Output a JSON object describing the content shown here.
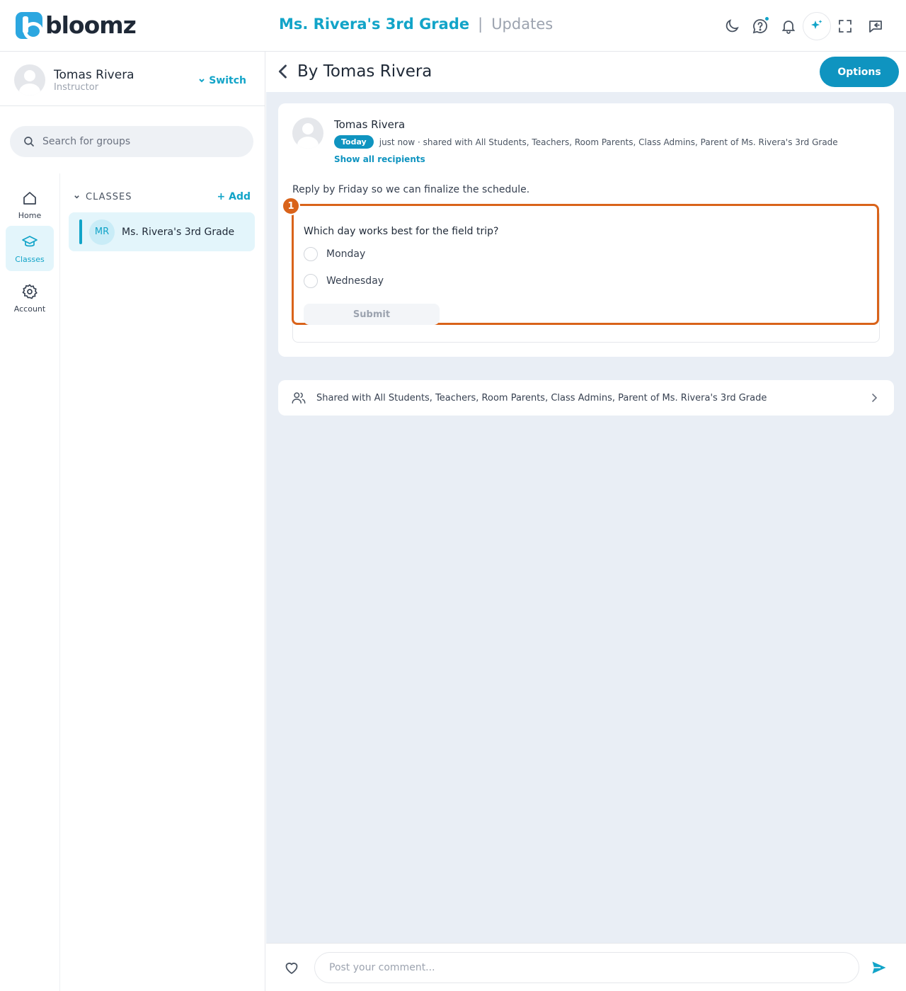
{
  "app": {
    "logo_text": "bloomz",
    "brand_color": "#12a4c8",
    "accent_color": "#0f94c0",
    "highlight_color": "#d9631a"
  },
  "header": {
    "class_name": "Ms. Rivera's 3rd Grade",
    "separator": "|",
    "page": "Updates",
    "icons": [
      "moon-icon",
      "help-chat-icon",
      "bell-icon",
      "sparkle-ai-icon",
      "fullscreen-icon",
      "collapse-panel-icon"
    ]
  },
  "user": {
    "name": "Tomas Rivera",
    "role": "Instructor",
    "switch_label": "Switch"
  },
  "search": {
    "placeholder": "Search for groups"
  },
  "rail": {
    "home": "Home",
    "classes": "Classes",
    "account": "Account"
  },
  "classes": {
    "title": "CLASSES",
    "add_label": "+ Add",
    "items": [
      {
        "initials": "MR",
        "name": "Ms. Rivera's 3rd Grade"
      }
    ]
  },
  "main": {
    "title": "By Tomas Rivera",
    "options_label": "Options"
  },
  "post": {
    "author": "Tomas Rivera",
    "badge": "Today",
    "meta": "just now · shared with All Students, Teachers, Room Parents, Class Admins, Parent of Ms. Rivera's 3rd Grade",
    "show_all": "Show all recipients",
    "body": "Reply by Friday so we can finalize the schedule.",
    "poll": {
      "question": "Which day works best for the field trip?",
      "options": [
        "Monday",
        "Wednesday"
      ],
      "submit_label": "Submit"
    },
    "marker": "1"
  },
  "shared": {
    "text": "Shared with All Students, Teachers, Room Parents, Class Admins, Parent of Ms. Rivera's 3rd Grade"
  },
  "comment": {
    "placeholder": "Post your comment..."
  }
}
